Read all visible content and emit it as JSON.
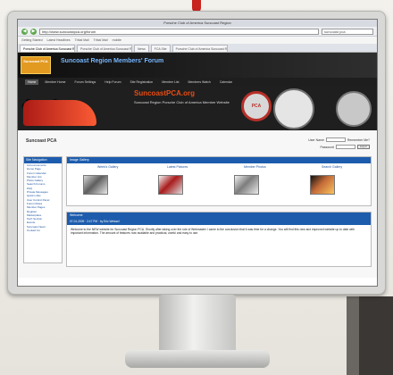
{
  "browser": {
    "window_title": "Porsche Club of America Suncoast Region",
    "address": "http://www.suncoastpca.org/forum",
    "search": "suncoast pca",
    "bookmarks": [
      "Getting Started",
      "Latest Headlines",
      "Tribal Mail",
      "Tribal Mail",
      "mobile"
    ],
    "tabs": [
      "Porsche Club of America Suncoast Region",
      "Porsche Club of America Suncoast Region",
      "News",
      "FCA Site",
      "Porsche Club of America Suncoast Region"
    ]
  },
  "site": {
    "logo_text": "Suncoast PCA",
    "title": "Suncoast Region Members' Forum",
    "nav": [
      "Home",
      "Member Home",
      "Forum Settings",
      "Help Forum",
      "Site Registration",
      "Member List",
      "Members Watch",
      "Calendar"
    ],
    "banner_label": "SuncoastPCA.org",
    "banner_tagline": "Suncoast Region Porsche Club of America Member Website",
    "badge": "PCA"
  },
  "forum": {
    "title": "Suncoast PCA",
    "login": {
      "user_label": "User Name",
      "password_label": "Password",
      "remember": "Remember Me?",
      "button": "Log in"
    },
    "sidebar_title": "Site Navigation",
    "sidebar_links": [
      "Announcements",
      "Home Page",
      "Forum Calendar",
      "Member List",
      "Photo Gallery",
      "Search Forums",
      "FAQ",
      "Private Messages",
      "Quick Links",
      "User Control Panel",
      "Forum Rules",
      "Member Pages",
      "Register",
      "Marketplace",
      "Tech Section",
      "Events",
      "Suncoast News",
      "Contact Us"
    ],
    "gallery_title": "Image Gallery",
    "gallery_captions": [
      "Week's Gallery",
      "Latest Pictures",
      "Member Photos",
      "Search Gallery"
    ],
    "welcome_title": "Welcome",
    "welcome_meta": "07-01-2009 · 2:47 PM · by Eric Weissel",
    "welcome_text": "Welcome to the NEW website for Suncoast Region PCA. Shortly after taking over the role of Webmaster I came to the conclusion that it was time for a change. You will find this new and improved website up to date with important information. The amount of features now available and practical, useful and easy to use."
  }
}
